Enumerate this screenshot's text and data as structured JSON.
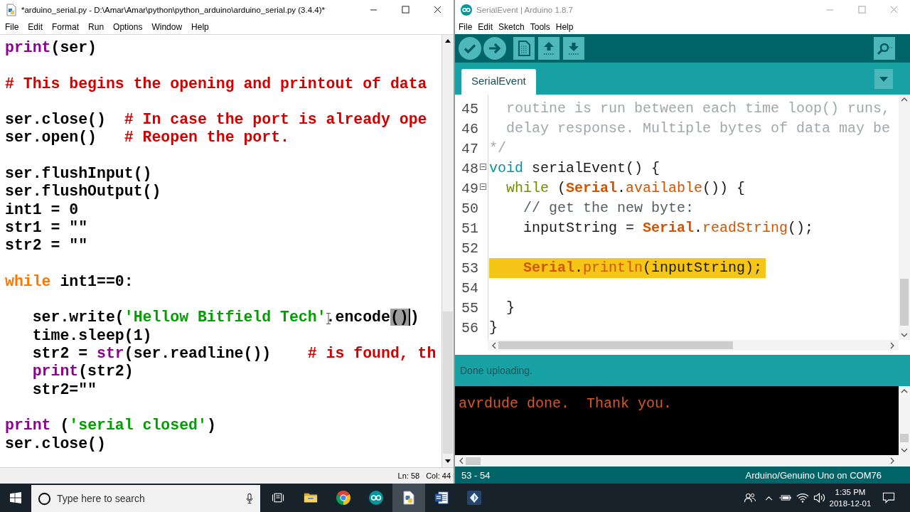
{
  "idle_window": {
    "title": "*arduino_serial.py - D:\\Amar\\Amar\\python\\python_arduino\\arduino_serial.py (3.4.4)*",
    "active": true,
    "menu": [
      "File",
      "Edit",
      "Format",
      "Run",
      "Options",
      "Window",
      "Help"
    ],
    "code_blocks": [
      {
        "lines": [
          {
            "tokens": [
              {
                "kind": "builtin",
                "text": "print"
              },
              {
                "kind": "plain",
                "text": "(ser)"
              }
            ]
          }
        ]
      },
      {
        "lines": [
          {
            "tokens": [
              {
                "kind": "comment",
                "text": "# This begins the opening and printout of data"
              }
            ]
          }
        ]
      },
      {
        "lines": [
          {
            "tokens": [
              {
                "kind": "plain",
                "text": "ser.close()"
              },
              {
                "kind": "comment",
                "text": "  # In case the port is already ope"
              }
            ]
          },
          {
            "tokens": [
              {
                "kind": "plain",
                "text": "ser.open()"
              },
              {
                "kind": "comment",
                "text": "   # Reopen the port."
              }
            ]
          }
        ]
      },
      {
        "lines": [
          {
            "tokens": [
              {
                "kind": "plain",
                "text": "ser.flushInput()"
              }
            ]
          },
          {
            "tokens": [
              {
                "kind": "plain",
                "text": "ser.flushOutput()"
              }
            ]
          },
          {
            "tokens": [
              {
                "kind": "plain",
                "text": "int1 = 0"
              }
            ]
          },
          {
            "tokens": [
              {
                "kind": "plain",
                "text": "str1 = \"\""
              }
            ]
          },
          {
            "tokens": [
              {
                "kind": "plain",
                "text": "str2 = \"\""
              }
            ]
          }
        ]
      },
      {
        "lines": [
          {
            "tokens": [
              {
                "kind": "keyword",
                "text": "while"
              },
              {
                "kind": "plain",
                "text": " int1==0:"
              }
            ]
          }
        ]
      },
      {
        "lines": [
          {
            "tokens": [
              {
                "kind": "plain",
                "text": "   ser.write("
              },
              {
                "kind": "string",
                "text": "'Hellow Bitfield Tech'"
              },
              {
                "kind": "plain",
                "text": ".encode"
              },
              {
                "kind": "selection",
                "text": "()"
              },
              {
                "kind": "plain",
                "text": ")"
              }
            ]
          },
          {
            "tokens": [
              {
                "kind": "plain",
                "text": "   time.sleep(1)"
              }
            ]
          },
          {
            "tokens": [
              {
                "kind": "plain",
                "text": "   str2 = "
              },
              {
                "kind": "builtin",
                "text": "str"
              },
              {
                "kind": "plain",
                "text": "(ser.readline())"
              },
              {
                "kind": "comment",
                "text": "    # is found, th"
              }
            ]
          },
          {
            "tokens": [
              {
                "kind": "builtin",
                "text": "   print"
              },
              {
                "kind": "plain",
                "text": "(str2)"
              }
            ]
          },
          {
            "tokens": [
              {
                "kind": "plain",
                "text": "   str2=\"\""
              }
            ]
          }
        ]
      },
      {
        "lines": [
          {
            "tokens": [
              {
                "kind": "builtin",
                "text": "print"
              },
              {
                "kind": "plain",
                "text": " ("
              },
              {
                "kind": "string",
                "text": "'serial closed'"
              },
              {
                "kind": "plain",
                "text": ")"
              }
            ]
          },
          {
            "tokens": [
              {
                "kind": "plain",
                "text": "ser.close()"
              }
            ]
          }
        ]
      }
    ],
    "status": {
      "line": "Ln: 58",
      "column": "Col: 44"
    }
  },
  "arduino_window": {
    "title": "SerialEvent | Arduino 1.8.7",
    "active": false,
    "menu": [
      "File",
      "Edit",
      "Sketch",
      "Tools",
      "Help"
    ],
    "tabs": [
      {
        "label": "SerialEvent",
        "selected": true
      }
    ],
    "code_lines": [
      {
        "number": "45",
        "fold": false,
        "highlighted": false,
        "tokens": [
          {
            "kind": "comment",
            "text": "  routine is run between each time loop() runs,"
          }
        ]
      },
      {
        "number": "46",
        "fold": false,
        "highlighted": false,
        "tokens": [
          {
            "kind": "comment",
            "text": "  delay response. Multiple bytes of data may be"
          }
        ]
      },
      {
        "number": "47",
        "fold": false,
        "highlighted": false,
        "tokens": [
          {
            "kind": "comment",
            "text": "*/"
          }
        ]
      },
      {
        "number": "48",
        "fold": true,
        "highlighted": false,
        "tokens": [
          {
            "kind": "type",
            "text": "void"
          },
          {
            "kind": "plain",
            "text": " serialEvent() {"
          }
        ]
      },
      {
        "number": "49",
        "fold": true,
        "highlighted": false,
        "tokens": [
          {
            "kind": "keyword",
            "text": "  while"
          },
          {
            "kind": "plain",
            "text": " ("
          },
          {
            "kind": "class",
            "text": "Serial"
          },
          {
            "kind": "plain",
            "text": "."
          },
          {
            "kind": "method",
            "text": "available"
          },
          {
            "kind": "plain",
            "text": "()) {"
          }
        ]
      },
      {
        "number": "50",
        "fold": false,
        "highlighted": false,
        "tokens": [
          {
            "kind": "line_comment",
            "text": "    // get the new byte:"
          }
        ]
      },
      {
        "number": "51",
        "fold": false,
        "highlighted": false,
        "tokens": [
          {
            "kind": "plain",
            "text": "    inputString = "
          },
          {
            "kind": "class",
            "text": "Serial"
          },
          {
            "kind": "plain",
            "text": "."
          },
          {
            "kind": "method",
            "text": "readString"
          },
          {
            "kind": "plain",
            "text": "();"
          }
        ]
      },
      {
        "number": "52",
        "fold": false,
        "highlighted": false
      },
      {
        "number": "53",
        "fold": false,
        "highlighted": true,
        "tokens": [
          {
            "kind": "class",
            "text": "    Serial"
          },
          {
            "kind": "plain",
            "text": "."
          },
          {
            "kind": "method",
            "text": "println"
          },
          {
            "kind": "plain",
            "text": "(inputString);"
          }
        ]
      },
      {
        "number": "54",
        "fold": false,
        "highlighted": false
      },
      {
        "number": "55",
        "fold": false,
        "highlighted": false,
        "tokens": [
          {
            "kind": "plain",
            "text": "  }"
          }
        ]
      },
      {
        "number": "56",
        "fold": false,
        "highlighted": false,
        "tokens": [
          {
            "kind": "plain",
            "text": "}"
          }
        ]
      }
    ],
    "message": "Done uploading.",
    "console_lines": [
      "avrdude done.  Thank you."
    ],
    "status": {
      "line_range": "53 - 54",
      "board": "Arduino/Genuino Uno on COM76"
    }
  },
  "taskbar": {
    "search": {
      "placeholder": "Type here to search"
    },
    "apps": [
      {
        "selected": false
      },
      {
        "selected": false
      },
      {
        "selected": false
      },
      {
        "selected": true
      },
      {
        "selected": false
      },
      {
        "selected": false
      }
    ],
    "clock": {
      "time": "1:35 PM",
      "date": "2018-12-01"
    }
  }
}
